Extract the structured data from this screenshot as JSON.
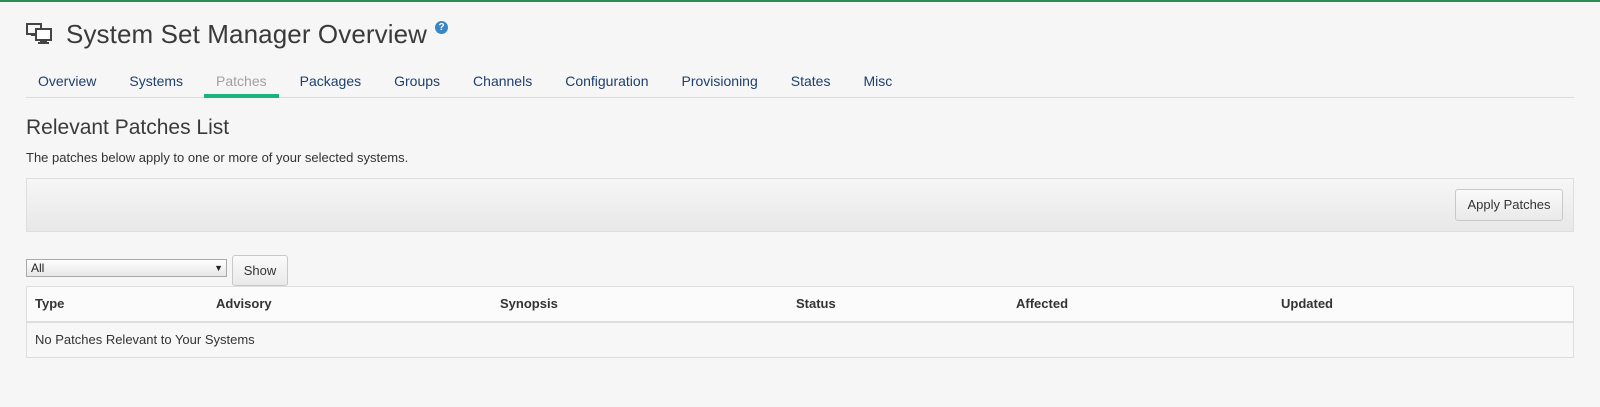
{
  "header": {
    "title": "System Set Manager Overview",
    "help_icon": "?",
    "icon": "system-set-icon"
  },
  "tabs": [
    {
      "label": "Overview",
      "active": false
    },
    {
      "label": "Systems",
      "active": false
    },
    {
      "label": "Patches",
      "active": true
    },
    {
      "label": "Packages",
      "active": false
    },
    {
      "label": "Groups",
      "active": false
    },
    {
      "label": "Channels",
      "active": false
    },
    {
      "label": "Configuration",
      "active": false
    },
    {
      "label": "Provisioning",
      "active": false
    },
    {
      "label": "States",
      "active": false
    },
    {
      "label": "Misc",
      "active": false
    }
  ],
  "section": {
    "title": "Relevant Patches List",
    "description": "The patches below apply to one or more of your selected systems."
  },
  "actions": {
    "apply_label": "Apply Patches"
  },
  "filter": {
    "selected": "All",
    "show_label": "Show"
  },
  "table": {
    "columns": [
      "Type",
      "Advisory",
      "Synopsis",
      "Status",
      "Affected",
      "Updated"
    ],
    "empty_message": "No Patches Relevant to Your Systems"
  },
  "colors": {
    "accent": "#19b37b",
    "link": "#1d3f6e",
    "top_border": "#2e8b57",
    "help_badge": "#3b86c4"
  }
}
